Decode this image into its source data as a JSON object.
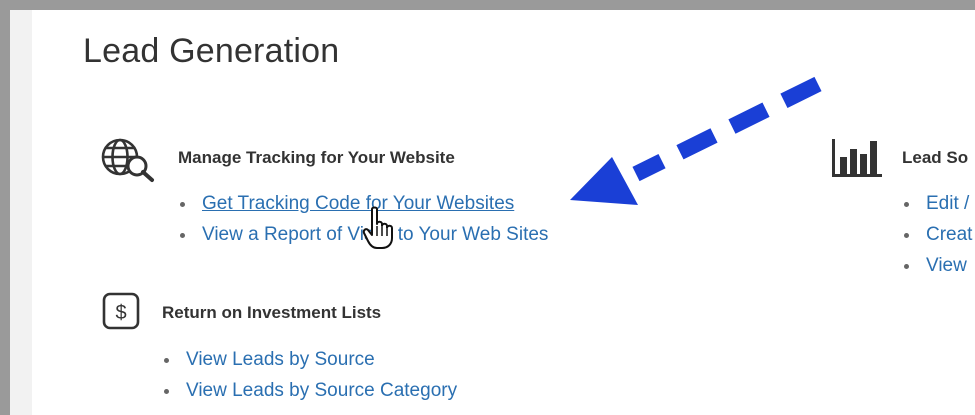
{
  "page": {
    "title": "Lead Generation"
  },
  "sections": {
    "tracking": {
      "heading": "Manage Tracking for Your Website",
      "icon": "globe-search-icon",
      "links": [
        {
          "label": "Get Tracking Code for Your Websites"
        },
        {
          "label": "View a Report of Visits to Your Web Sites"
        }
      ]
    },
    "roi": {
      "heading": "Return on Investment Lists",
      "icon": "dollar-icon",
      "links": [
        {
          "label": "View Leads by Source"
        },
        {
          "label": "View Leads by Source Category"
        }
      ]
    },
    "lead_sources": {
      "heading": "Lead So",
      "icon": "bar-chart-icon",
      "links": [
        {
          "label": "Edit /"
        },
        {
          "label": "Creat"
        },
        {
          "label": "View"
        }
      ]
    }
  },
  "annotation": {
    "arrow_icon": "dashed-arrow-icon",
    "arrow_color": "#1a3fd6"
  },
  "cursor": {
    "icon": "hand-pointer-icon"
  },
  "colors": {
    "link": "#2a6fb1",
    "heading": "#333333",
    "background": "#ffffff",
    "frame": "#9a9a9a"
  }
}
